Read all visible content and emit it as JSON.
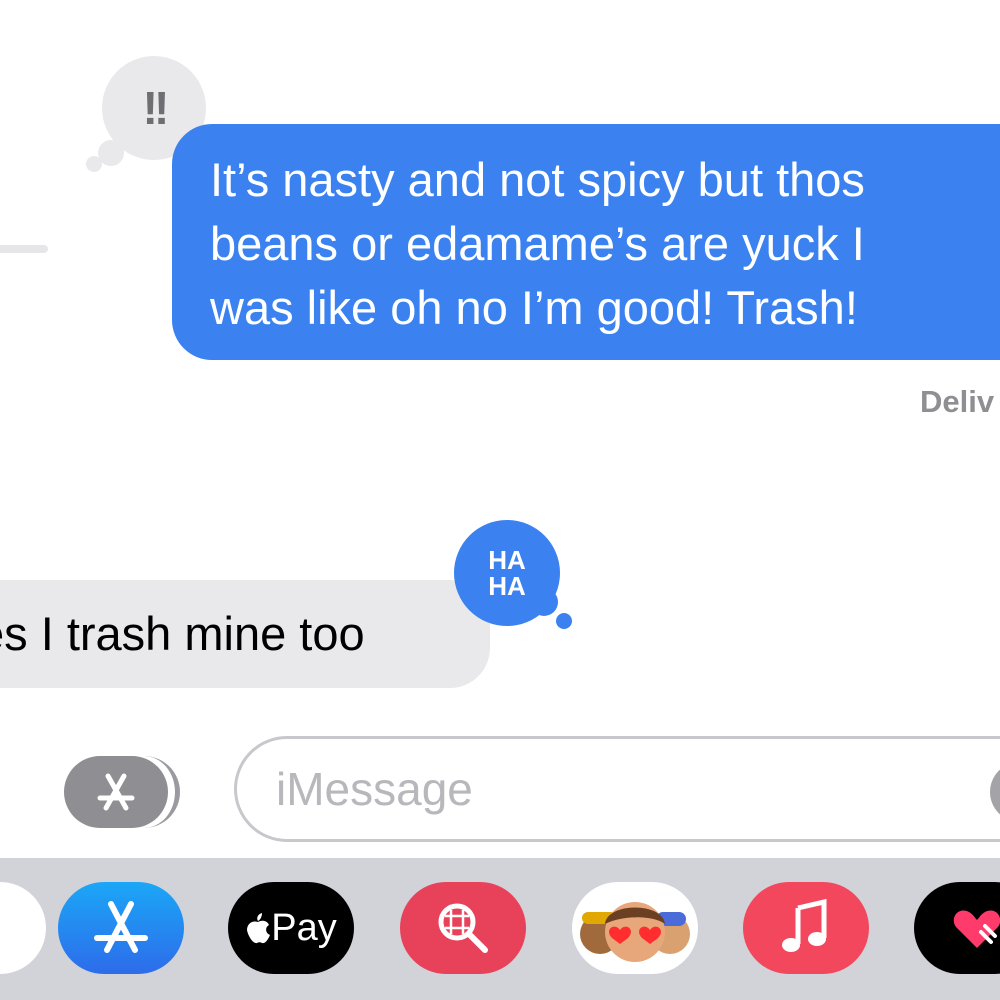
{
  "conversation": {
    "sent_message": "It’s nasty and not spicy but thos\nbeans or edamame’s are yuck I\nwas like oh no I’m good! Trash!",
    "sent_tapback": "!!",
    "delivered_label": "Deliv",
    "received_message": "es I trash mine too",
    "received_tapback_line1": "HA",
    "received_tapback_line2": "HA"
  },
  "input": {
    "placeholder": "iMessage"
  },
  "app_drawer": {
    "apps": [
      {
        "icon": "photos-icon"
      },
      {
        "icon": "app-store-icon"
      },
      {
        "icon": "apple-pay-icon",
        "label": "Pay"
      },
      {
        "icon": "image-search-icon"
      },
      {
        "icon": "memoji-stickers-icon"
      },
      {
        "icon": "music-icon"
      },
      {
        "icon": "digital-touch-icon"
      }
    ]
  },
  "colors": {
    "sent_bubble": "#3b82f0",
    "received_bubble": "#e9e9eb",
    "drawer_bg": "#d2d3d8"
  }
}
